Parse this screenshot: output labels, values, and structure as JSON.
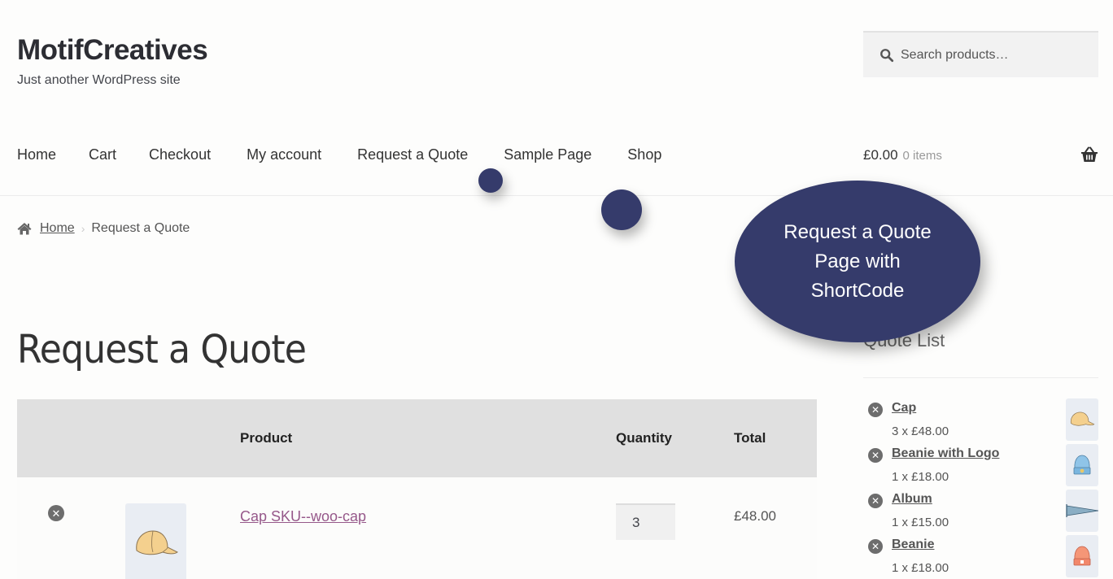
{
  "site": {
    "title": "MotifCreatives",
    "tagline": "Just another WordPress site"
  },
  "search": {
    "placeholder": "Search products…",
    "icon": "search-icon"
  },
  "nav": {
    "items": [
      {
        "label": "Home"
      },
      {
        "label": "Cart"
      },
      {
        "label": "Checkout"
      },
      {
        "label": "My account"
      },
      {
        "label": "Request a Quote"
      },
      {
        "label": "Sample Page"
      },
      {
        "label": "Shop"
      }
    ]
  },
  "cart": {
    "amount": "£0.00",
    "count": "0 items",
    "icon": "basket-icon"
  },
  "breadcrumb": {
    "home": "Home",
    "current": "Request a Quote",
    "separator": "›"
  },
  "page": {
    "title": "Request a Quote"
  },
  "table": {
    "headers": {
      "product": "Product",
      "quantity": "Quantity",
      "total": "Total"
    },
    "rows": [
      {
        "product": "Cap SKU--woo-cap",
        "quantity": "3",
        "total": "£48.00",
        "remove_icon": "✕",
        "thumb": "cap"
      }
    ]
  },
  "sidebar": {
    "title": "Quote List",
    "items": [
      {
        "name": "Cap ",
        "qty": "3 x £48.00",
        "thumb": "cap"
      },
      {
        "name": "Beanie with Logo ",
        "qty": "1 x £18.00",
        "thumb": "beanie-logo"
      },
      {
        "name": "Album ",
        "qty": "1 x £15.00",
        "thumb": "pennant"
      },
      {
        "name": "Beanie ",
        "qty": "1 x £18.00",
        "thumb": "beanie"
      }
    ]
  },
  "callout": {
    "text": "Request a Quote Page with ShortCode",
    "color": "#353b6b"
  },
  "colors": {
    "link": "#96588a",
    "accent": "#353b6b",
    "table_header_bg": "#e0e0e0"
  }
}
